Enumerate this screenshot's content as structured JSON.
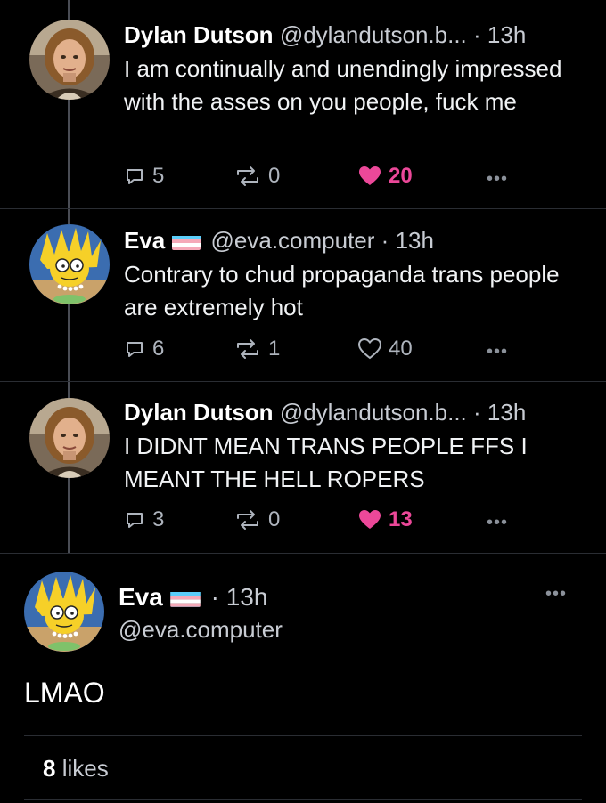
{
  "posts": [
    {
      "author": "Dylan Dutson",
      "handle": "@dylandutson.b...",
      "time": "13h",
      "text": "I am continually and unendingly impressed with the asses on you people, fuck me",
      "replies": "5",
      "reposts": "0",
      "likes": "20",
      "liked": true,
      "avatar": "man-photo-avatar"
    },
    {
      "author": "Eva",
      "handle": "@eva.computer",
      "time": "13h",
      "text": "Contrary to chud propaganda trans people are extremely hot",
      "replies": "6",
      "reposts": "1",
      "likes": "40",
      "liked": false,
      "avatar": "cartoon-avatar",
      "flag": "trans-flag"
    },
    {
      "author": "Dylan Dutson",
      "handle": "@dylandutson.b...",
      "time": "13h",
      "text": "I DIDNT MEAN TRANS PEOPLE FFS I MEANT THE HELL ROPERS",
      "replies": "3",
      "reposts": "0",
      "likes": "13",
      "liked": true,
      "avatar": "man-photo-avatar"
    }
  ],
  "focus": {
    "author": "Eva",
    "handle": "@eva.computer",
    "time": "13h",
    "text": "LMAO",
    "likes_count": "8",
    "likes_label": "likes",
    "flag": "trans-flag",
    "avatar": "cartoon-avatar"
  },
  "symbols": {
    "dot": "·",
    "more": "•••"
  },
  "colors": {
    "background": "#000000",
    "like_active": "#ec4899",
    "muted_text": "#aeb4bd",
    "thread_line": "#4a4d55",
    "divider": "#2a2d33",
    "trans_blue": "#5bcefa",
    "trans_pink": "#f5a9b8",
    "trans_white": "#ffffff"
  }
}
